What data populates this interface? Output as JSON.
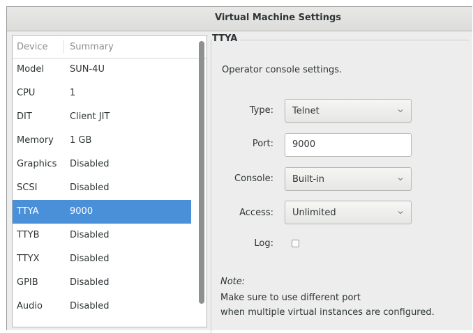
{
  "window": {
    "title": "Virtual Machine Settings"
  },
  "device_list": {
    "columns": {
      "device": "Device",
      "summary": "Summary"
    },
    "rows": [
      {
        "device": "Model",
        "summary": "SUN-4U"
      },
      {
        "device": "CPU",
        "summary": "1"
      },
      {
        "device": "DIT",
        "summary": "Client JIT"
      },
      {
        "device": "Memory",
        "summary": "1 GB"
      },
      {
        "device": "Graphics",
        "summary": "Disabled"
      },
      {
        "device": "SCSI",
        "summary": "Disabled"
      },
      {
        "device": "TTYA",
        "summary": "9000"
      },
      {
        "device": "TTYB",
        "summary": "Disabled"
      },
      {
        "device": "TTYX",
        "summary": "Disabled"
      },
      {
        "device": "GPIB",
        "summary": "Disabled"
      },
      {
        "device": "Audio",
        "summary": "Disabled"
      }
    ],
    "selected_device": "TTYA"
  },
  "panel": {
    "frame_label": "TTYA",
    "description": "Operator console settings.",
    "type": {
      "label": "Type:",
      "value": "Telnet"
    },
    "port": {
      "label": "Port:",
      "value": "9000"
    },
    "console": {
      "label": "Console:",
      "value": "Built-in"
    },
    "access": {
      "label": "Access:",
      "value": "Unlimited"
    },
    "log": {
      "label": "Log:",
      "checked": false
    },
    "note": {
      "title": "Note:",
      "line1": "Make sure to use different port",
      "line2": "when multiple virtual instances are configured."
    }
  },
  "colors": {
    "selection": "#4a90d9",
    "window_bg": "#ededed"
  }
}
